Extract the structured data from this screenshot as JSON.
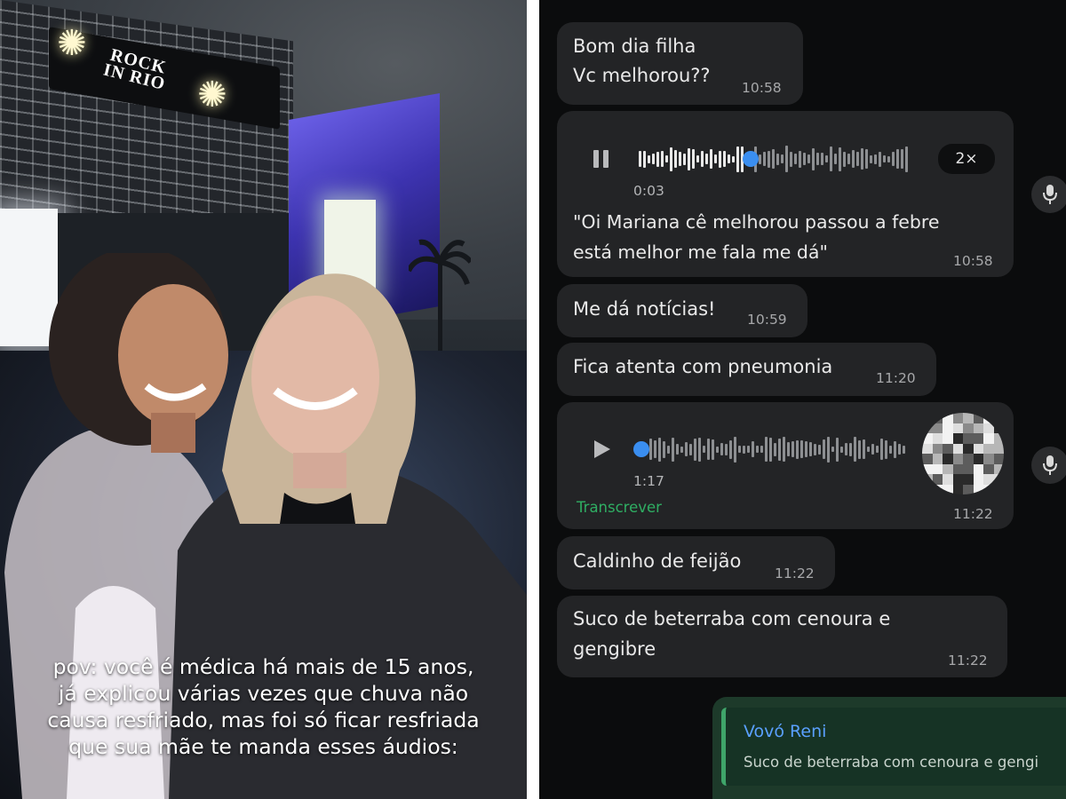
{
  "photo": {
    "stage_logo_top": "ROCK",
    "stage_logo_bottom": "IN RIO",
    "caption_lines": [
      "pov: você é médica há mais de 15 anos,",
      "já explicou várias vezes que chuva não",
      "causa resfriado, mas foi só ficar resfriada",
      "que sua mãe te manda esses áudios:"
    ]
  },
  "chat": {
    "messages": [
      {
        "lines": [
          "Bom dia filha",
          "Vc melhorou??"
        ],
        "time": "10:58"
      },
      {
        "type": "audio",
        "elapsed": "0:03",
        "speed": "2×",
        "transcript_lines": [
          "\"Oi Mariana cê melhorou passou a febre",
          "está melhor me fala me dá\""
        ],
        "time": "10:58"
      },
      {
        "lines": [
          "Me dá notícias!"
        ],
        "time": "10:59"
      },
      {
        "lines": [
          "Fica atenta com pneumonia"
        ],
        "time": "11:20"
      },
      {
        "type": "audio",
        "duration": "1:17",
        "transcribe_label": "Transcrever",
        "time": "11:22"
      },
      {
        "lines": [
          "Caldinho de feijão"
        ],
        "time": "11:22"
      },
      {
        "lines": [
          "Suco de beterraba com cenoura e",
          "gengibre"
        ],
        "time": "11:22"
      }
    ],
    "reply": {
      "sender": "Vovó Reni",
      "quoted": "Suco de beterraba com cenoura e gengi"
    },
    "colors": {
      "background": "#0b0c0d",
      "bubble": "#232426",
      "accent_blue": "#3a8ef0",
      "transcribe_green": "#2fae63",
      "reply_name": "#5aa0ff"
    },
    "icons": [
      "pause-icon",
      "play-icon",
      "mic-icon"
    ]
  }
}
